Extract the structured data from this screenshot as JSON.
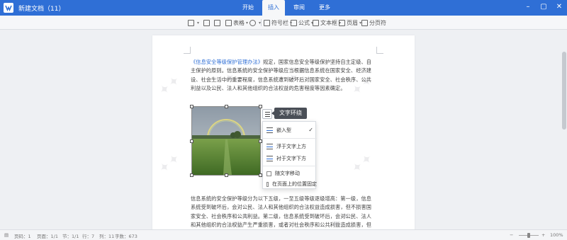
{
  "window": {
    "title": "新建文档（11）",
    "controls": [
      "minimize-icon",
      "maximize-icon",
      "close-icon"
    ]
  },
  "tabs": [
    {
      "label": "开始",
      "active": false
    },
    {
      "label": "插入",
      "active": true
    },
    {
      "label": "审阅",
      "active": false
    },
    {
      "label": "更多",
      "active": false
    }
  ],
  "toolbar": {
    "items": [
      {
        "icon": "paragraph-icon",
        "label": "",
        "dropdown": true
      },
      {
        "icon": "link-icon",
        "label": ""
      },
      {
        "icon": "image-icon",
        "label": ""
      },
      {
        "icon": "table-icon",
        "label": "表格",
        "dropdown": true
      },
      {
        "icon": "shape-icon",
        "label": "",
        "dropdown": true
      },
      {
        "icon": "symbol-icon",
        "label": "符号栏",
        "dropdown": true
      },
      {
        "icon": "formula-icon",
        "label": "公式",
        "dropdown": true
      },
      {
        "icon": "textbox-icon",
        "label": "文本框",
        "dropdown": true
      },
      {
        "icon": "header-icon",
        "label": "页眉",
        "dropdown": true
      },
      {
        "icon": "page-break-icon",
        "label": "分页符"
      }
    ]
  },
  "document": {
    "para1_link": "《信息安全等级保护管理办法》",
    "para1_text": "规定，国家信息安全等级保护坚持自主定级、自主保护的原则。信息系统的安全保护等级应当根据信息系统在国家安全、经济建设、社会生活中的重要程度，信息系统遭到破坏后对国家安全、社会秩序、公共利益以及公民、法人和其他组织的合法权益的危害程度等因素确定。",
    "para2_text": "信息系统的安全保护等级分为以下五级，一至五级等级逐级增高：第一级，信息系统受到破坏后，会对公民、法人和其他组织的合法权益造成损害，但不损害国家安全、社会秩序和公共利益。第二级，信息系统受到破坏后，会对公民、法人和其他组织的合法权益产生严重损害，或者对社会秩序和公共利益造成损害，但不损害国家安全。第三级，信息系统受到破坏后，会对社会秩序和公共利益造成严重损害，或者对国家安全造成损害。"
  },
  "image_toolbar": {
    "wrap_button_icon": "text-wrap-icon",
    "tooltip": "文字环绕"
  },
  "wrap_menu": {
    "items": [
      {
        "label": "嵌入型",
        "icon": "inline-wrap-icon",
        "checked": true
      },
      {
        "label": "浮于文字上方",
        "icon": "in-front-wrap-icon",
        "checked": false
      },
      {
        "label": "衬于文字下方",
        "icon": "behind-wrap-icon",
        "checked": false
      }
    ],
    "options": [
      {
        "label": "随文字移动",
        "checked": false
      },
      {
        "label": "在页面上的位置固定",
        "checked": false
      }
    ]
  },
  "statusbar": {
    "page": "页码：1",
    "pages": "页面：1/1",
    "section": "节：1/1",
    "row": "行：7",
    "column": "列：11",
    "words": "字数：673",
    "zoom": "100%"
  },
  "colors": {
    "accent": "#2f6fd6",
    "tooltip_bg": "#4a4f57"
  }
}
